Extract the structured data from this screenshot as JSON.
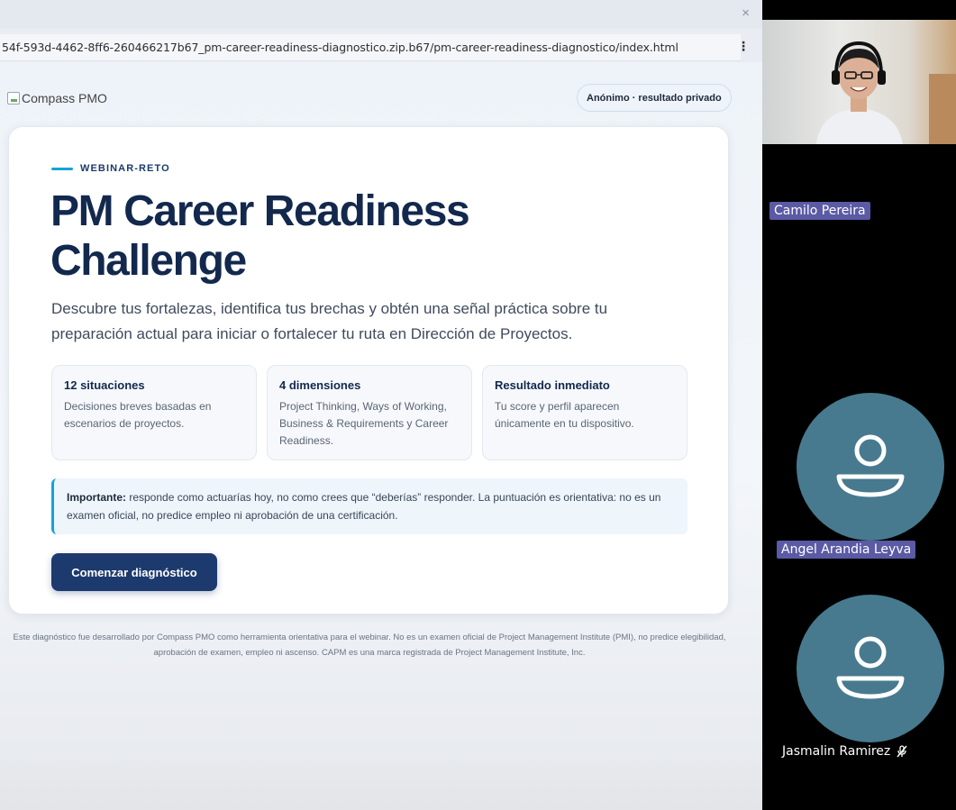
{
  "browser": {
    "close_glyph": "×",
    "url": "54f-593d-4462-8ff6-260466217b67_pm-career-readiness-diagnostico.zip.b67/pm-career-readiness-diagnostico/index.html",
    "menu_glyph": "⋮"
  },
  "header": {
    "logo_alt": "Compass PMO",
    "privacy_badge": "Anónimo · resultado privado"
  },
  "hero": {
    "eyebrow": "WEBINAR-RETO",
    "title": "PM Career Readiness Challenge",
    "subtitle": "Descubre tus fortalezas, identifica tus brechas y obtén una señal práctica sobre tu preparación actual para iniciar o fortalecer tu ruta en Dirección de Proyectos."
  },
  "features": [
    {
      "title": "12 situaciones",
      "desc": "Decisiones breves basadas en escenarios de proyectos."
    },
    {
      "title": "4 dimensiones",
      "desc": "Project Thinking, Ways of Working, Business & Requirements y Career Readiness."
    },
    {
      "title": "Resultado inmediato",
      "desc": "Tu score y perfil aparecen únicamente en tu dispositivo."
    }
  ],
  "notice": {
    "strong": "Importante:",
    "text": " responde como actuarías hoy, no como crees que “deberías” responder. La puntuación es orientativa: no es un examen oficial, no predice empleo ni aprobación de una certificación."
  },
  "cta": {
    "label": "Comenzar diagnóstico"
  },
  "footer": {
    "disclaimer": "Este diagnóstico fue desarrollado por Compass PMO como herramienta orientativa para el webinar. No es un examen oficial de Project Management Institute (PMI), no predice elegibilidad, aprobación de examen, empleo ni ascenso. CAPM es una marca registrada de Project Management Institute, Inc."
  },
  "participants": [
    {
      "name": "Camilo Pereira",
      "video": true
    },
    {
      "name": "Angel Arandia Leyva",
      "video": false,
      "icon": "person-icon"
    },
    {
      "name": "Jasmalin Ramirez",
      "video": false,
      "icon": "person-icon",
      "muted_icon": "mic-off-icon"
    }
  ],
  "colors": {
    "primary": "#1d3a6e",
    "title": "#13284d",
    "accent": "#16a3d6",
    "avatar_bg": "#477a8e",
    "name_tag_bg": "#5b5aa5"
  }
}
